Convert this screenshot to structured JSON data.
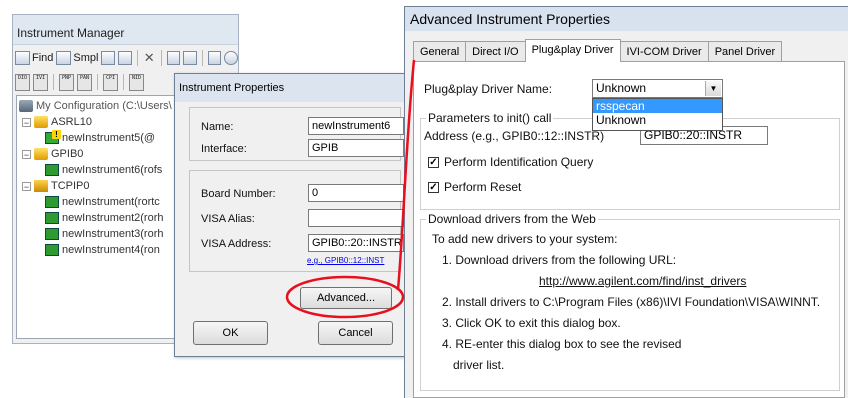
{
  "instrument_manager": {
    "title": "Instrument Manager",
    "toolbar1": {
      "find_label": "Find",
      "smpl_label": "Smpl"
    },
    "toolbar2_icons": [
      "DIO",
      "IVI",
      "PNP",
      "PAN",
      "CPI",
      "NID"
    ],
    "tree": {
      "root": "My Configuration (C:\\Users\\",
      "items": [
        {
          "label": "ASRL10",
          "type": "port"
        },
        {
          "label": "newInstrument5(@",
          "type": "instrument-warn"
        },
        {
          "label": "GPIB0",
          "type": "port"
        },
        {
          "label": "newInstrument6(rofs",
          "type": "instrument"
        },
        {
          "label": "TCPIP0",
          "type": "port"
        },
        {
          "label": "newInstrument(rortc",
          "type": "instrument"
        },
        {
          "label": "newInstrument2(rorh",
          "type": "instrument"
        },
        {
          "label": "newInstrument3(rorh",
          "type": "instrument"
        },
        {
          "label": "newInstrument4(ron",
          "type": "instrument"
        }
      ]
    }
  },
  "instrument_properties": {
    "title": "Instrument Properties",
    "name_label": "Name:",
    "name_value": "newInstrument6",
    "interface_label": "Interface:",
    "interface_value": "GPIB",
    "board_number_label": "Board Number:",
    "board_number_value": "0",
    "visa_alias_label": "VISA Alias:",
    "visa_alias_value": "",
    "visa_address_label": "VISA Address:",
    "visa_address_value": "GPIB0::20::INSTR",
    "visa_address_hint": "e.g., GPIB0::12::INST",
    "advanced_button": "Advanced...",
    "ok_button": "OK",
    "cancel_button": "Cancel"
  },
  "advanced_properties": {
    "title": "Advanced Instrument Properties",
    "tabs": [
      {
        "label": "General",
        "active": false
      },
      {
        "label": "Direct I/O",
        "active": false
      },
      {
        "label": "Plug&play Driver",
        "active": true
      },
      {
        "label": "IVI-COM Driver",
        "active": false
      },
      {
        "label": "Panel Driver",
        "active": false
      }
    ],
    "driver_name_label": "Plug&play Driver Name:",
    "driver_name_value": "Unknown",
    "driver_options": [
      {
        "label": "rsspecan",
        "selected": true
      },
      {
        "label": "Unknown",
        "selected": false
      }
    ],
    "init_group_label": "Parameters to init() call",
    "address_label": "Address (e.g., GPIB0::12::INSTR)",
    "address_value": "GPIB0::20::INSTR",
    "id_query_label": "Perform Identification Query",
    "id_query_checked": true,
    "reset_label": "Perform Reset",
    "reset_checked": true,
    "download_group_label": "Download drivers from the Web",
    "download_intro": "To add new drivers to your system:",
    "step1": "1. Download drivers from the following URL:",
    "url": "http://www.agilent.com/find/inst_drivers",
    "step2": "2. Install drivers to C:\\Program Files (x86)\\IVI Foundation\\VISA\\WINNT.",
    "step3": "3. Click OK to exit this dialog box.",
    "step4": "4. RE-enter this dialog box to see the revised",
    "step4_cont": "driver list."
  },
  "colors": {
    "annotation": "#e8101e",
    "link": "#0000ee",
    "selection": "#3399ff"
  }
}
